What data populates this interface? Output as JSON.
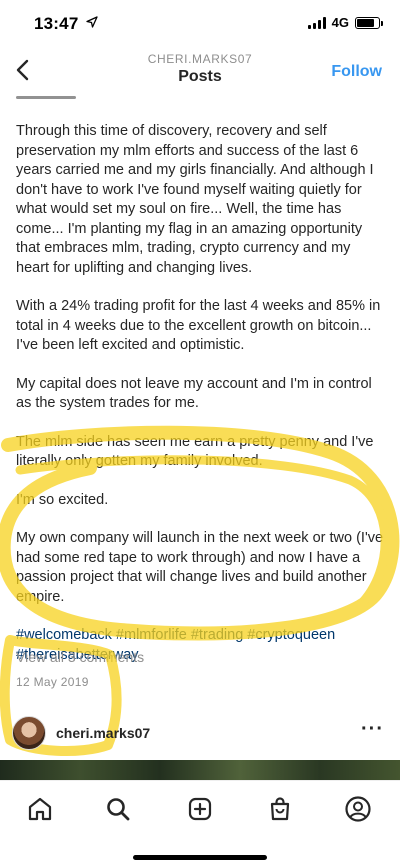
{
  "status_bar": {
    "time": "13:47",
    "network": "4G",
    "battery_level": 0.8
  },
  "nav": {
    "username": "CHERI.MARKS07",
    "title": "Posts",
    "follow_label": "Follow"
  },
  "caption": {
    "paragraphs": [
      "Through this time of discovery, recovery and self preservation my mlm efforts and success of the last 6 years carried me and my girls financially. And although I don't have to work I've found myself waiting quietly for what would set my soul on fire... Well, the time has come... I'm planting my flag in an amazing opportunity that embraces mlm, trading, crypto currency and my heart for uplifting and changing lives.",
      "With a 24% trading profit for the last 4 weeks and 85% in total in 4 weeks due to the excellent growth on bitcoin... I've been left excited and optimistic.",
      "My capital does not leave my account and I'm in control as the system trades for me.",
      "The mlm side has seen me earn a pretty penny and I've literally only gotten my family involved.",
      "I'm so excited.",
      "My own company will launch in the next week or two (I've had some red tape to work through) and now I have a passion project that will change lives and build another empire."
    ],
    "hashtags": "#welcomeback #mlmforlife #trading #cryptoqueen #thereisabetterway"
  },
  "comments_link": "View all 3 comments",
  "post_date": "12 May 2019",
  "next_post": {
    "username": "cheri.marks07",
    "more_label": "···"
  },
  "tab_bar": {
    "items": [
      "home-icon",
      "search-icon",
      "new-post-icon",
      "shop-icon",
      "profile-icon"
    ]
  },
  "colors": {
    "link_blue": "#3897f0",
    "hashtag": "#00376b",
    "muted": "#8e8e8e",
    "highlighter": "#f7d21e"
  }
}
